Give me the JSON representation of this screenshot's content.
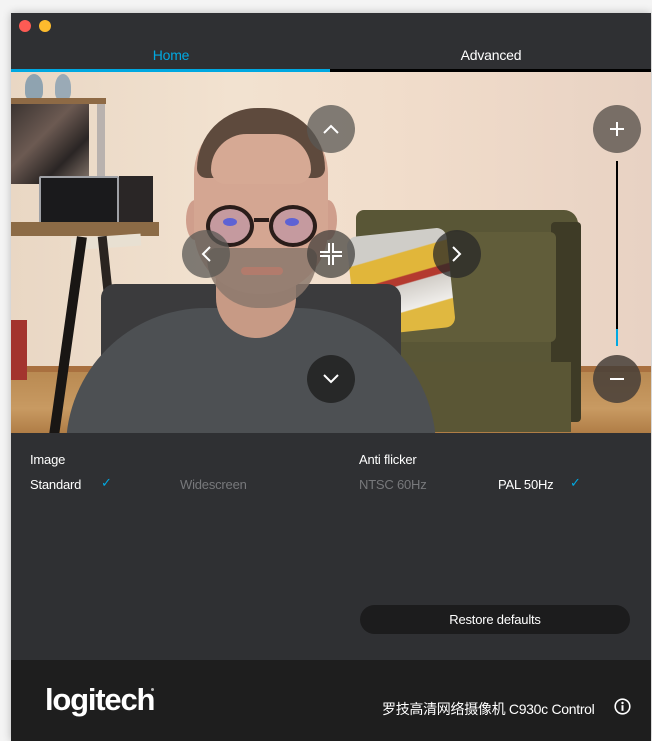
{
  "window": {
    "traffic_lights": [
      "close",
      "minimize"
    ]
  },
  "tabs": [
    {
      "label": "Home",
      "active": true
    },
    {
      "label": "Advanced",
      "active": false
    }
  ],
  "preview": {
    "pan_controls": [
      "up",
      "left",
      "recenter",
      "right",
      "down"
    ],
    "zoom": {
      "in_icon": "plus-icon",
      "out_icon": "minus-icon",
      "level_fraction": 0.09
    }
  },
  "image": {
    "label": "Image",
    "options": [
      {
        "label": "Standard",
        "selected": true
      },
      {
        "label": "Widescreen",
        "selected": false
      }
    ]
  },
  "anti_flicker": {
    "label": "Anti flicker",
    "options": [
      {
        "label": "NTSC 60Hz",
        "selected": false
      },
      {
        "label": "PAL 50Hz",
        "selected": true
      }
    ]
  },
  "check_glyph": "✓",
  "restore_label": "Restore defaults",
  "footer": {
    "logo": "logitech",
    "product_name": "罗技高清网络摄像机 C930c Control",
    "info_icon": "info-icon"
  },
  "colors": {
    "accent": "#00a8e1",
    "background": "#2f3033",
    "footer": "#1e1e1e",
    "button": "#1c1c1d"
  }
}
